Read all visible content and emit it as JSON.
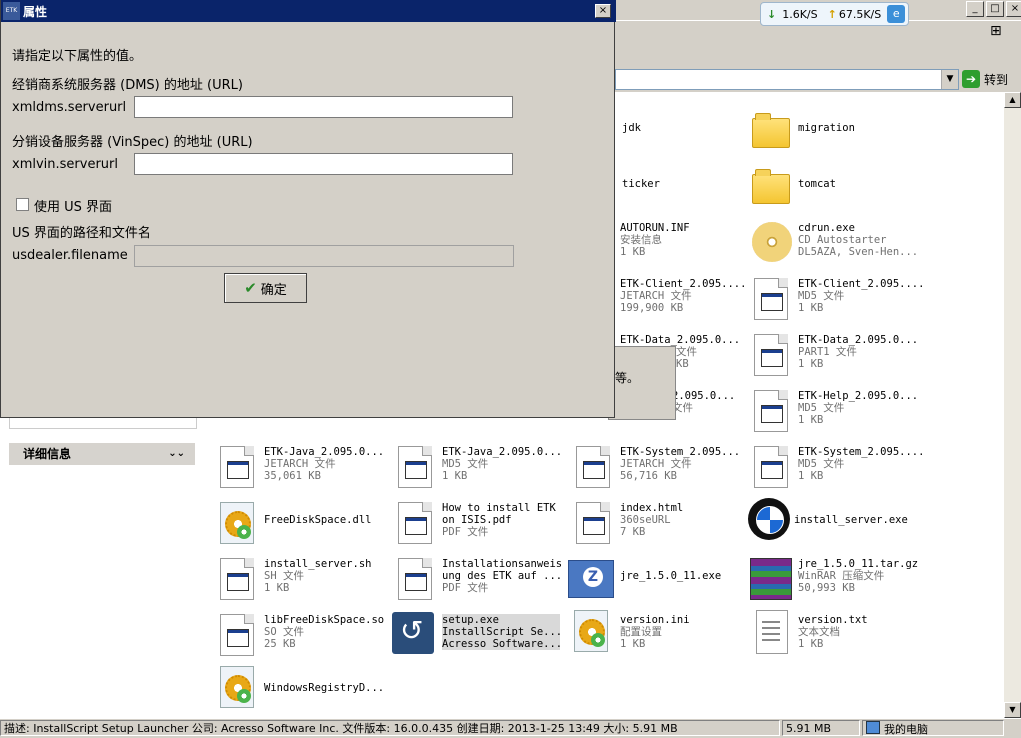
{
  "netmeter": {
    "down": "1.6K/S",
    "up": "67.5K/S"
  },
  "address": {
    "go_label": "转到"
  },
  "window_controls": {
    "min": "_",
    "max": "□",
    "close": "×"
  },
  "left_panel": {
    "details_label": "详细信息"
  },
  "files": [
    {
      "name": "jdk",
      "type": "",
      "size": ""
    },
    {
      "name": "migration",
      "type": "",
      "size": ""
    },
    {
      "name": "ticker",
      "type": "",
      "size": ""
    },
    {
      "name": "tomcat",
      "type": "",
      "size": ""
    },
    {
      "name": "AUTORUN.INF",
      "type": "安装信息",
      "size": "1 KB"
    },
    {
      "name": "cdrun.exe",
      "type": "CD Autostarter",
      "size": "DL5AZA, Sven-Hen..."
    },
    {
      "name": "ETK-Client_2.095....",
      "type": "JETARCH 文件",
      "size": "199,900 KB"
    },
    {
      "name": "ETK-Client_2.095....",
      "type": "MD5 文件",
      "size": "1 KB"
    },
    {
      "name": "ETK-Data_2.095.0...",
      "type": "文件",
      "size": "KB"
    },
    {
      "name": "ETK-Data_2.095.0...",
      "type": "PART1 文件",
      "size": "1 KB"
    },
    {
      "name": "2.095.0...",
      "type": "文件",
      "size": "KB"
    },
    {
      "name": "ETK-Help_2.095.0...",
      "type": "MD5 文件",
      "size": "1 KB"
    },
    {
      "name": "ETK-Java_2.095.0...",
      "type": "JETARCH 文件",
      "size": "35,061 KB"
    },
    {
      "name": "ETK-Java_2.095.0...",
      "type": "MD5 文件",
      "size": "1 KB"
    },
    {
      "name": "ETK-System_2.095...",
      "type": "JETARCH 文件",
      "size": "56,716 KB"
    },
    {
      "name": "ETK-System_2.095....",
      "type": "MD5 文件",
      "size": "1 KB"
    },
    {
      "name": "FreeDiskSpace.dll",
      "type": "",
      "size": ""
    },
    {
      "name": "How to install ETK",
      "type": "on ISIS.pdf",
      "size": "PDF 文件"
    },
    {
      "name": "index.html",
      "type": "360seURL",
      "size": "7 KB"
    },
    {
      "name": "install_server.exe",
      "type": "",
      "size": ""
    },
    {
      "name": "install_server.sh",
      "type": "SH 文件",
      "size": "1 KB"
    },
    {
      "name": "Installationsanweis",
      "type": "ung des ETK auf ...",
      "size": "PDF 文件"
    },
    {
      "name": "jre_1.5.0_11.exe",
      "type": "",
      "size": ""
    },
    {
      "name": "jre_1.5.0_11.tar.gz",
      "type": "WinRAR 压缩文件",
      "size": "50,993 KB"
    },
    {
      "name": "libFreeDiskSpace.so",
      "type": "SO 文件",
      "size": "25 KB"
    },
    {
      "name": "setup.exe",
      "type": "InstallScript Se...",
      "size": "Acresso Software..."
    },
    {
      "name": "version.ini",
      "type": "配置设置",
      "size": "1 KB"
    },
    {
      "name": "version.txt",
      "type": "文本文档",
      "size": "1 KB"
    },
    {
      "name": "WindowsRegistryD...",
      "type": "",
      "size": ""
    }
  ],
  "bg_dialog": {
    "text": "等。"
  },
  "dialog": {
    "title": "属性",
    "intro": "请指定以下属性的值。",
    "dms_label": "经销商系统服务器 (DMS) 的地址 (URL)",
    "dms_key": "xmldms.serverurl",
    "dms_value": "",
    "vin_label": "分销设备服务器 (VinSpec) 的地址 (URL)",
    "vin_key": "xmlvin.serverurl",
    "vin_value": "",
    "us_checkbox_label": "使用 US 界面",
    "us_path_label": "US 界面的路径和文件名",
    "us_key": "usdealer.filename",
    "us_value": "",
    "ok_label": "确定",
    "close": "×",
    "app_icon": "ETK"
  },
  "statusbar": {
    "description": "描述: InstallScript Setup Launcher 公司: Acresso Software Inc. 文件版本: 16.0.0.435 创建日期: 2013-1-25 13:49 大小: 5.91 MB",
    "size": "5.91 MB",
    "location": "我的电脑"
  }
}
